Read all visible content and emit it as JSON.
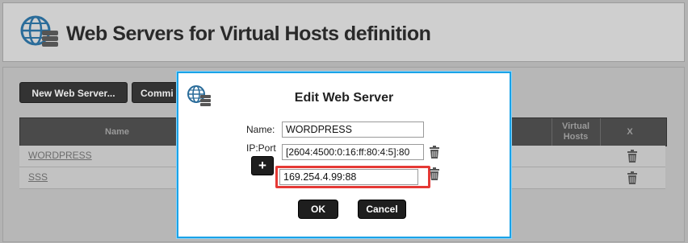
{
  "header": {
    "title": "Web Servers for Virtual Hosts definition",
    "icon": "globe-server-icon"
  },
  "toolbar": {
    "new_web_server": "New Web Server...",
    "commit": "Commi"
  },
  "table": {
    "columns": {
      "name": "Name",
      "virtual_hosts": "Virtual Hosts",
      "delete": "X"
    },
    "rows": [
      {
        "name": "WORDPRESS"
      },
      {
        "name": "SSS"
      }
    ]
  },
  "dialog": {
    "title": "Edit Web Server",
    "icon": "globe-server-icon",
    "name_label": "Name:",
    "name_value": "WORDPRESS",
    "ipport_label": "IP:Port",
    "ip_entries": [
      "[2604:4500:0:16:ff:80:4:5]:80",
      "169.254.4.99:88"
    ],
    "add_button": "+",
    "ok_button": "OK",
    "cancel_button": "Cancel"
  },
  "colors": {
    "accent_border": "#1aa3e8",
    "highlight": "#e53935",
    "dark_button": "#1e1e1e"
  }
}
